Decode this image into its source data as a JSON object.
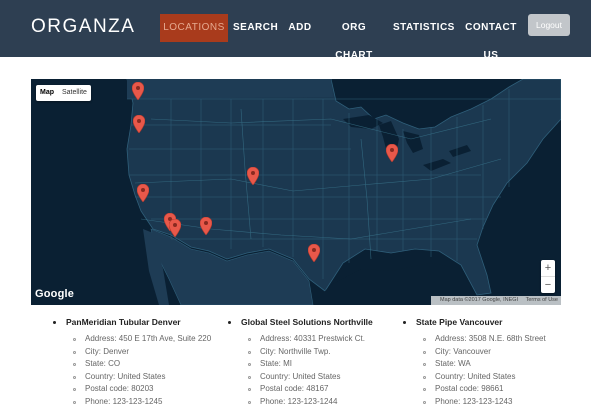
{
  "brand": "ORGANZA",
  "nav": {
    "items": [
      {
        "label": "LOCATIONS",
        "active": true
      },
      {
        "label": "SEARCH"
      },
      {
        "label": "ADD"
      },
      {
        "label": "ORG CHART"
      },
      {
        "label": "STATISTICS"
      },
      {
        "label": "CONTACT US"
      }
    ],
    "logout_label": "Logout"
  },
  "map": {
    "type_options": [
      "Map",
      "Satellite"
    ],
    "selected_type": "Map",
    "zoom_in": "+",
    "zoom_out": "−",
    "logo": "Google",
    "attribution": "Map data ©2017 Google, INEGI",
    "terms": "Terms of Use",
    "marker_icon": "map-pin-icon",
    "marker_color": "#e8584a",
    "water_color": "#0a2033",
    "land_color": "#1b3850"
  },
  "locations": [
    {
      "name": "PanMeridian Tubular Denver",
      "address": "Address: 450 E 17th Ave, Suite 220",
      "city": "City: Denver",
      "state": "State: CO",
      "country": "Country: United States",
      "postal": "Postal code: 80203",
      "phone": "Phone: 123-123-1245"
    },
    {
      "name": "Global Steel Solutions Northville",
      "address": "Address: 40331 Prestwick Ct.",
      "city": "City: Northville Twp.",
      "state": "State: MI",
      "country": "Country: United States",
      "postal": "Postal code: 48167",
      "phone": "Phone: 123-123-1244"
    },
    {
      "name": "State Pipe Vancouver",
      "address": "Address: 3508 N.E. 68th Street",
      "city": "City: Vancouver",
      "state": "State: WA",
      "country": "Country: United States",
      "postal": "Postal code: 98661",
      "phone": "Phone: 123-123-1243"
    }
  ]
}
